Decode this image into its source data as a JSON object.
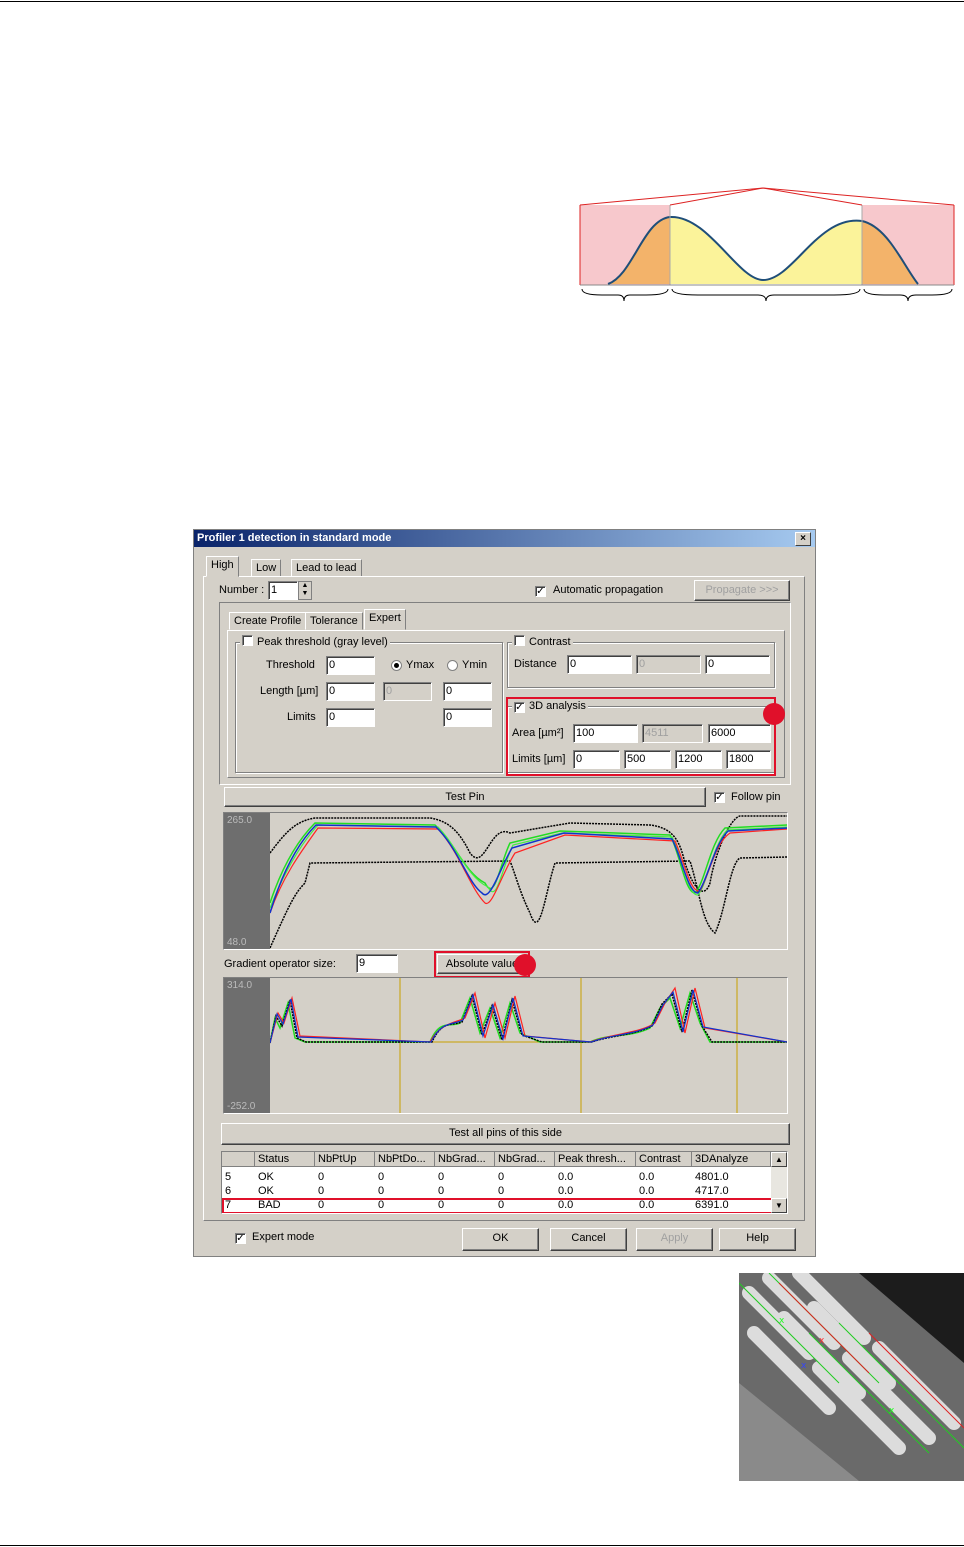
{
  "dialog": {
    "title": "Profiler 1 detection in standard mode",
    "close_label": "×",
    "tabs": [
      "High",
      "Low",
      "Lead to lead"
    ],
    "number_label": "Number :",
    "number_value": "1",
    "auto_propagation_label": "Automatic propagation",
    "auto_propagation_checked": true,
    "propagate_label": "Propagate >>>",
    "subtabs": [
      "Create Profile",
      "Tolerance",
      "Expert"
    ],
    "peak": {
      "label": "Peak threshold (gray level)",
      "checked": false,
      "threshold_label": "Threshold",
      "threshold_value": "0",
      "ymax_label": "Ymax",
      "ymin_label": "Ymin",
      "length_label": "Length [µm]",
      "length_value": "0",
      "length_mid": "0",
      "length_right": "0",
      "limits_label": "Limits",
      "limits_value": "0",
      "limits_right": "0"
    },
    "contrast": {
      "label": "Contrast",
      "checked": false,
      "distance_label": "Distance",
      "v1": "0",
      "v2": "0",
      "v3": "0"
    },
    "analysis3d": {
      "label": "3D analysis",
      "checked": true,
      "area_label": "Area [µm²]",
      "area_min": "100",
      "area_current": "4511",
      "area_max": "6000",
      "limits_label": "Limits [µm]",
      "limits": [
        "0",
        "500",
        "1200",
        "1800"
      ]
    },
    "test_pin_label": "Test Pin",
    "follow_pin_label": "Follow pin",
    "plot1": {
      "ymax": "265.0",
      "ymin": "48.0"
    },
    "gradient_label": "Gradient operator size:",
    "gradient_value": "9",
    "absolute_value_label": "Absolute value",
    "plot2": {
      "ymax": "314.0",
      "ymin": "-252.0"
    },
    "test_all_label": "Test all pins of this side",
    "table": {
      "headers": [
        "",
        "Status",
        "NbPtUp",
        "NbPtDo...",
        "NbGrad...",
        "NbGrad...",
        "Peak thresh...",
        "Contrast",
        "3DAnalyze"
      ],
      "rows": [
        [
          "5",
          "OK",
          "0",
          "0",
          "0",
          "0",
          "0.0",
          "0.0",
          "4801.0"
        ],
        [
          "6",
          "OK",
          "0",
          "0",
          "0",
          "0",
          "0.0",
          "0.0",
          "4717.0"
        ],
        [
          "7",
          "BAD",
          "0",
          "0",
          "0",
          "0",
          "0.0",
          "0.0",
          "6391.0"
        ]
      ]
    },
    "expert_mode_label": "Expert mode",
    "ok_label": "OK",
    "cancel_label": "Cancel",
    "apply_label": "Apply",
    "help_label": "Help"
  },
  "colors": {
    "highlight": "#e0102a",
    "titlebar": "#0a246a",
    "face": "#d4d0c8"
  }
}
